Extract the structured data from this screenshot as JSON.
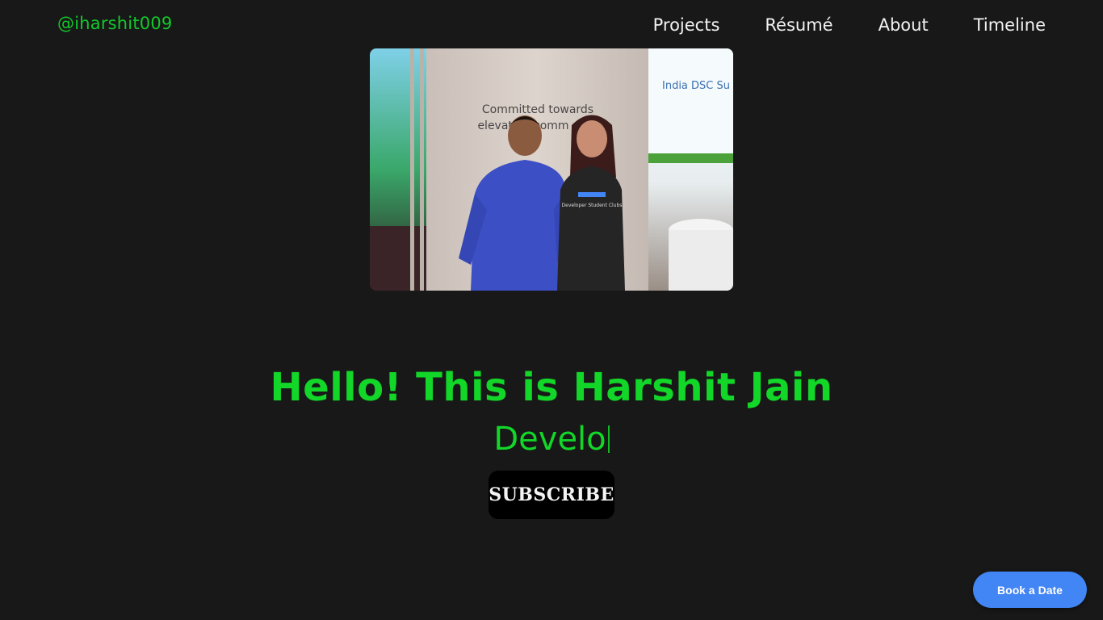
{
  "header": {
    "brand": "@iharshit009",
    "nav": [
      "Projects",
      "Résumé",
      "About",
      "Timeline"
    ]
  },
  "hero": {
    "photo": {
      "banner_line_1": "Committed towards",
      "banner_line_2": "elevating comm",
      "screen_text": "India DSC Su",
      "shirt_text": "Developer Student Clubs"
    },
    "title": "Hello! This is Harshit Jain",
    "subtitle": "Develo"
  },
  "subscribe": {
    "label": "SUBSCRIBE"
  },
  "floating": {
    "book_label": "Book a Date"
  },
  "colors": {
    "background": "#181818",
    "accent_green": "#12d628",
    "book_button": "#4285f4"
  }
}
